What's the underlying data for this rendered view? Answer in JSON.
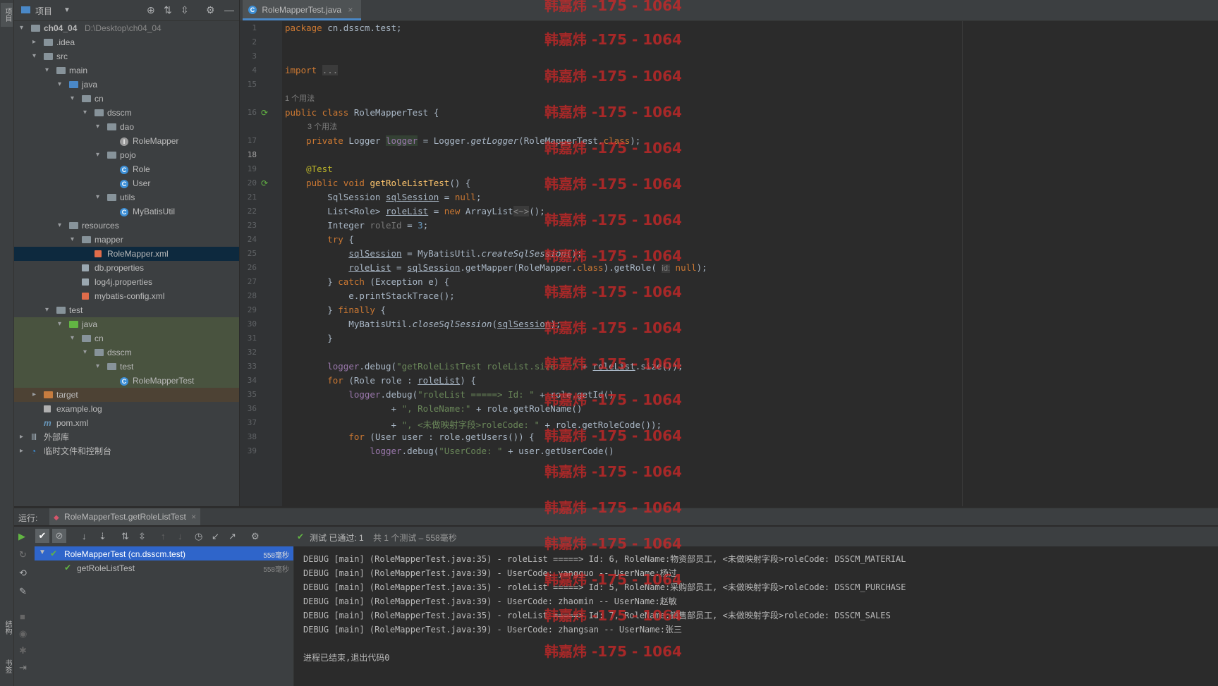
{
  "side_strip": {
    "top_label": "项目",
    "bottom_label_1": "结构",
    "bottom_label_2": "书签"
  },
  "project_panel": {
    "title": "项目",
    "tree": [
      {
        "label": "ch04_04",
        "path": "D:\\Desktop\\ch04_04",
        "depth": 0,
        "type": "module",
        "expanded": true
      },
      {
        "label": ".idea",
        "depth": 1,
        "type": "folder",
        "expanded": false
      },
      {
        "label": "src",
        "depth": 1,
        "type": "folder",
        "expanded": true
      },
      {
        "label": "main",
        "depth": 2,
        "type": "folder",
        "expanded": true
      },
      {
        "label": "java",
        "depth": 3,
        "type": "folder-blue",
        "expanded": true
      },
      {
        "label": "cn",
        "depth": 4,
        "type": "package",
        "expanded": true
      },
      {
        "label": "dsscm",
        "depth": 5,
        "type": "package",
        "expanded": true
      },
      {
        "label": "dao",
        "depth": 6,
        "type": "package",
        "expanded": true
      },
      {
        "label": "RoleMapper",
        "depth": 7,
        "type": "mapper"
      },
      {
        "label": "pojo",
        "depth": 6,
        "type": "package",
        "expanded": true
      },
      {
        "label": "Role",
        "depth": 7,
        "type": "class"
      },
      {
        "label": "User",
        "depth": 7,
        "type": "class"
      },
      {
        "label": "utils",
        "depth": 6,
        "type": "package",
        "expanded": true
      },
      {
        "label": "MyBatisUtil",
        "depth": 7,
        "type": "class"
      },
      {
        "label": "resources",
        "depth": 3,
        "type": "folder",
        "expanded": true
      },
      {
        "label": "mapper",
        "depth": 4,
        "type": "folder",
        "expanded": true
      },
      {
        "label": "RoleMapper.xml",
        "depth": 5,
        "type": "xml",
        "selected": true
      },
      {
        "label": "db.properties",
        "depth": 4,
        "type": "props"
      },
      {
        "label": "log4j.properties",
        "depth": 4,
        "type": "props"
      },
      {
        "label": "mybatis-config.xml",
        "depth": 4,
        "type": "xml"
      },
      {
        "label": "test",
        "depth": 2,
        "type": "folder",
        "expanded": true
      },
      {
        "label": "java",
        "depth": 3,
        "type": "folder-green",
        "expanded": true,
        "test": true
      },
      {
        "label": "cn",
        "depth": 4,
        "type": "package",
        "expanded": true,
        "test": true
      },
      {
        "label": "dsscm",
        "depth": 5,
        "type": "package",
        "expanded": true,
        "test": true
      },
      {
        "label": "test",
        "depth": 6,
        "type": "package",
        "expanded": true,
        "test": true
      },
      {
        "label": "RoleMapperTest",
        "depth": 7,
        "type": "class",
        "test": true
      },
      {
        "label": "target",
        "depth": 1,
        "type": "folder-orange",
        "expanded": false,
        "excluded": true
      },
      {
        "label": "example.log",
        "depth": 1,
        "type": "file"
      },
      {
        "label": "pom.xml",
        "depth": 1,
        "type": "maven"
      },
      {
        "label": "外部库",
        "depth": 0,
        "type": "lib",
        "expanded": false
      },
      {
        "label": "临时文件和控制台",
        "depth": 0,
        "type": "scratch",
        "expanded": false
      }
    ]
  },
  "editor": {
    "tab_label": "RoleMapperTest.java",
    "usage_hint_class": "1 个用法",
    "usage_hint_field": "3 个用法",
    "param_hint": "id:"
  },
  "run": {
    "label": "运行:",
    "config_tab": "RoleMapperTest.getRoleListTest",
    "status_passed": "测试 已通过: 1",
    "status_detail": "共 1 个测试 – 558毫秒",
    "tests": [
      {
        "name": "RoleMapperTest (cn.dsscm.test)",
        "time": "558毫秒",
        "selected": true
      },
      {
        "name": "getRoleListTest",
        "time": "558毫秒"
      }
    ],
    "console": [
      "DEBUG [main] (RoleMapperTest.java:35) - roleList =====> Id: 6, RoleName:物资部员工, <未做映射字段>roleCode: DSSCM_MATERIAL",
      "DEBUG [main] (RoleMapperTest.java:39) - UserCode: yangguo -- UserName:杨过",
      "DEBUG [main] (RoleMapperTest.java:35) - roleList =====> Id: 5, RoleName:采购部员工, <未做映射字段>roleCode: DSSCM_PURCHASE",
      "DEBUG [main] (RoleMapperTest.java:39) - UserCode: zhaomin -- UserName:赵敏",
      "DEBUG [main] (RoleMapperTest.java:35) - roleList =====> Id: 7, RoleName:销售部员工, <未做映射字段>roleCode: DSSCM_SALES",
      "DEBUG [main] (RoleMapperTest.java:39) - UserCode: zhangsan -- UserName:张三",
      "",
      "进程已结束,退出代码0"
    ]
  },
  "watermark": "韩嘉炜 -175 - 1064",
  "colors": {
    "accent": "#4a88c7",
    "keyword": "#cc7832",
    "string": "#6a8759",
    "number": "#6897bb",
    "pass": "#62b543"
  }
}
